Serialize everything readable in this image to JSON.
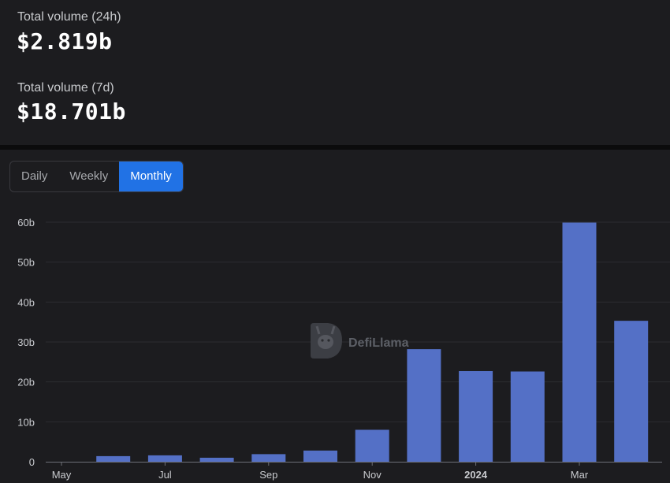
{
  "stats": {
    "volume_24h_label": "Total volume (24h)",
    "volume_24h_value": "$2.819b",
    "volume_7d_label": "Total volume (7d)",
    "volume_7d_value": "$18.701b"
  },
  "tabs": [
    {
      "label": "Daily",
      "active": false
    },
    {
      "label": "Weekly",
      "active": false
    },
    {
      "label": "Monthly",
      "active": true
    }
  ],
  "watermark": "DefiLlama",
  "colors": {
    "bar": "#5470c6",
    "accent": "#2172e5",
    "background": "#1c1c1f"
  },
  "chart_data": {
    "type": "bar",
    "categories": [
      "2023-05",
      "2023-06",
      "2023-07",
      "2023-08",
      "2023-09",
      "2023-10",
      "2023-11",
      "2023-12",
      "2024-01",
      "2024-02",
      "2024-03",
      "2024-04"
    ],
    "values": [
      0,
      1.4,
      1.6,
      1.0,
      1.9,
      2.8,
      8.0,
      28.2,
      22.7,
      22.6,
      59.9,
      35.3
    ],
    "unit": "b",
    "ylim": [
      0,
      60
    ],
    "yticks": [
      "0",
      "10b",
      "20b",
      "30b",
      "40b",
      "50b",
      "60b"
    ],
    "xticks": [
      {
        "category": "2023-05",
        "label": "May",
        "bold": false
      },
      {
        "category": "2023-07",
        "label": "Jul",
        "bold": false
      },
      {
        "category": "2023-09",
        "label": "Sep",
        "bold": false
      },
      {
        "category": "2023-11",
        "label": "Nov",
        "bold": false
      },
      {
        "category": "2024-01",
        "label": "2024",
        "bold": true
      },
      {
        "category": "2024-03",
        "label": "Mar",
        "bold": false
      }
    ],
    "grid": true,
    "legend": "none"
  }
}
